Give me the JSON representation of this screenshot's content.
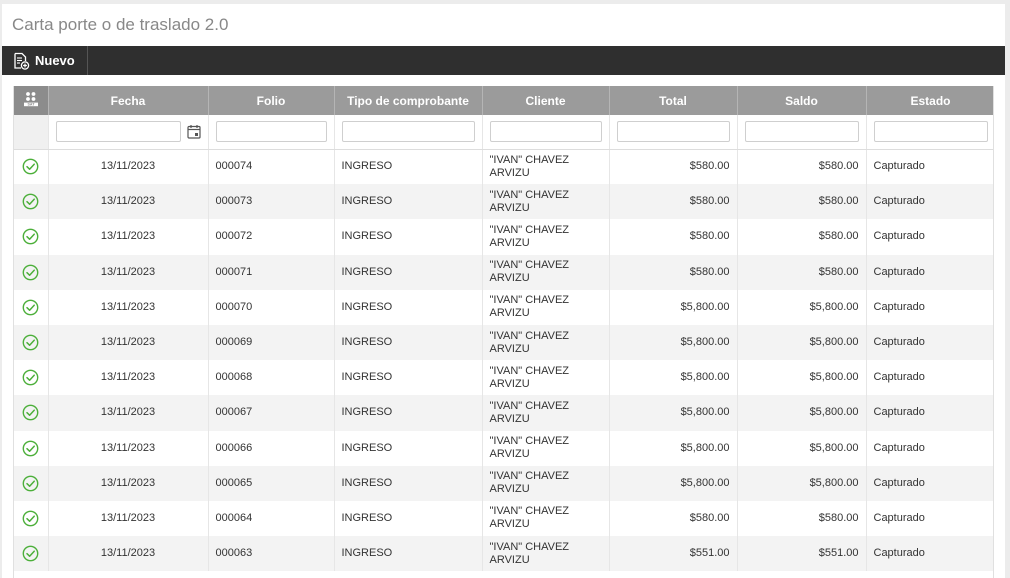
{
  "page": {
    "title": "Carta porte o de traslado 2.0"
  },
  "toolbar": {
    "nuevo_label": "Nuevo",
    "nuevo_icon": "document-add-icon"
  },
  "colors": {
    "toolbar_bg": "#2f2f2f",
    "header_bg": "#9b9b9b",
    "check_green": "#4caf3a"
  },
  "grid": {
    "sat_icon": "sat-icon",
    "columns": [
      "Fecha",
      "Folio",
      "Tipo de comprobante",
      "Cliente",
      "Total",
      "Saldo",
      "Estado"
    ],
    "rows": [
      {
        "status_icon": "check-circle-icon",
        "fecha": "13/11/2023",
        "folio": "000074",
        "tipo": "INGRESO",
        "cliente": "\"IVAN\" CHAVEZ ARVIZU",
        "total": "$580.00",
        "saldo": "$580.00",
        "estado": "Capturado"
      },
      {
        "status_icon": "check-circle-icon",
        "fecha": "13/11/2023",
        "folio": "000073",
        "tipo": "INGRESO",
        "cliente": "\"IVAN\" CHAVEZ ARVIZU",
        "total": "$580.00",
        "saldo": "$580.00",
        "estado": "Capturado"
      },
      {
        "status_icon": "check-circle-icon",
        "fecha": "13/11/2023",
        "folio": "000072",
        "tipo": "INGRESO",
        "cliente": "\"IVAN\" CHAVEZ ARVIZU",
        "total": "$580.00",
        "saldo": "$580.00",
        "estado": "Capturado"
      },
      {
        "status_icon": "check-circle-icon",
        "fecha": "13/11/2023",
        "folio": "000071",
        "tipo": "INGRESO",
        "cliente": "\"IVAN\" CHAVEZ ARVIZU",
        "total": "$580.00",
        "saldo": "$580.00",
        "estado": "Capturado"
      },
      {
        "status_icon": "check-circle-icon",
        "fecha": "13/11/2023",
        "folio": "000070",
        "tipo": "INGRESO",
        "cliente": "\"IVAN\" CHAVEZ ARVIZU",
        "total": "$5,800.00",
        "saldo": "$5,800.00",
        "estado": "Capturado"
      },
      {
        "status_icon": "check-circle-icon",
        "fecha": "13/11/2023",
        "folio": "000069",
        "tipo": "INGRESO",
        "cliente": "\"IVAN\" CHAVEZ ARVIZU",
        "total": "$5,800.00",
        "saldo": "$5,800.00",
        "estado": "Capturado"
      },
      {
        "status_icon": "check-circle-icon",
        "fecha": "13/11/2023",
        "folio": "000068",
        "tipo": "INGRESO",
        "cliente": "\"IVAN\" CHAVEZ ARVIZU",
        "total": "$5,800.00",
        "saldo": "$5,800.00",
        "estado": "Capturado"
      },
      {
        "status_icon": "check-circle-icon",
        "fecha": "13/11/2023",
        "folio": "000067",
        "tipo": "INGRESO",
        "cliente": "\"IVAN\" CHAVEZ ARVIZU",
        "total": "$5,800.00",
        "saldo": "$5,800.00",
        "estado": "Capturado"
      },
      {
        "status_icon": "check-circle-icon",
        "fecha": "13/11/2023",
        "folio": "000066",
        "tipo": "INGRESO",
        "cliente": "\"IVAN\" CHAVEZ ARVIZU",
        "total": "$5,800.00",
        "saldo": "$5,800.00",
        "estado": "Capturado"
      },
      {
        "status_icon": "check-circle-icon",
        "fecha": "13/11/2023",
        "folio": "000065",
        "tipo": "INGRESO",
        "cliente": "\"IVAN\" CHAVEZ ARVIZU",
        "total": "$5,800.00",
        "saldo": "$5,800.00",
        "estado": "Capturado"
      },
      {
        "status_icon": "check-circle-icon",
        "fecha": "13/11/2023",
        "folio": "000064",
        "tipo": "INGRESO",
        "cliente": "\"IVAN\" CHAVEZ ARVIZU",
        "total": "$580.00",
        "saldo": "$580.00",
        "estado": "Capturado"
      },
      {
        "status_icon": "check-circle-icon",
        "fecha": "13/11/2023",
        "folio": "000063",
        "tipo": "INGRESO",
        "cliente": "\"IVAN\" CHAVEZ ARVIZU",
        "total": "$551.00",
        "saldo": "$551.00",
        "estado": "Capturado"
      }
    ]
  }
}
